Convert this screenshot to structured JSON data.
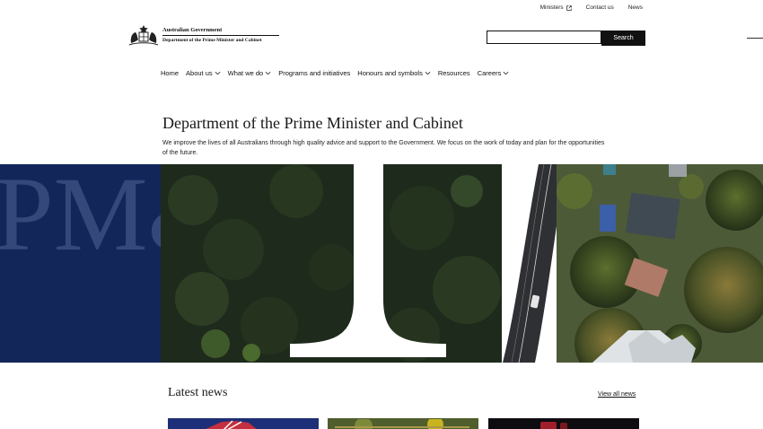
{
  "utility_nav": {
    "ministers": "Ministers",
    "contact": "Contact us",
    "news": "News"
  },
  "logo": {
    "government": "Australian Government",
    "department": "Department of the Prime Minister and Cabinet"
  },
  "search": {
    "value": "",
    "placeholder": "",
    "button_label": "Search"
  },
  "nav": {
    "items": [
      {
        "label": "Home",
        "has_dropdown": false
      },
      {
        "label": "About us",
        "has_dropdown": true
      },
      {
        "label": "What we do",
        "has_dropdown": true
      },
      {
        "label": "Programs and initiatives",
        "has_dropdown": false
      },
      {
        "label": "Honours and symbols",
        "has_dropdown": true
      },
      {
        "label": "Resources",
        "has_dropdown": false
      },
      {
        "label": "Careers",
        "has_dropdown": true
      }
    ]
  },
  "hero": {
    "title": "Department of the Prime Minister and Cabinet",
    "description": "We improve the lives of all Australians through high quality advice and support to the Government. We focus on the work of today and plan for the opportunities of the future."
  },
  "banner": {
    "watermark": "PM&C",
    "brand_color": "#13265a"
  },
  "news": {
    "heading": "Latest news",
    "view_all": "View all news"
  },
  "icons": {
    "ministers_link": "external-link-icon",
    "dropdown": "chevron-down-icon",
    "logo": "coat-of-arms-icon",
    "menu": "menu-icon"
  }
}
